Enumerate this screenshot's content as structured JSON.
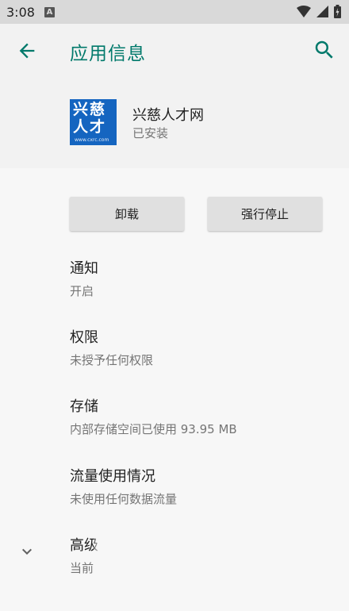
{
  "status_bar": {
    "time": "3:08",
    "notification_badge": "A",
    "icons": [
      "wifi-icon",
      "signal-icon",
      "battery-icon"
    ]
  },
  "app_bar": {
    "title": "应用信息",
    "back_icon": "arrow-left-icon",
    "search_icon": "search-icon",
    "accent_color": "#00796b"
  },
  "app": {
    "icon_line1": "兴慈",
    "icon_line2": "人才",
    "icon_url": "www.cxrc.com",
    "icon_color": "#1565c0",
    "name": "兴慈人才网",
    "status": "已安装"
  },
  "buttons": {
    "uninstall": "卸载",
    "force_stop": "强行停止"
  },
  "prefs": [
    {
      "title": "通知",
      "summary": "开启"
    },
    {
      "title": "权限",
      "summary": "未授予任何权限"
    },
    {
      "title": "存储",
      "summary": "内部存储空间已使用 93.95 MB"
    },
    {
      "title": "流量使用情况",
      "summary": "未使用任何数据流量"
    },
    {
      "title": "高级",
      "summary": "当前"
    }
  ],
  "expand_icon": "chevron-down-icon"
}
